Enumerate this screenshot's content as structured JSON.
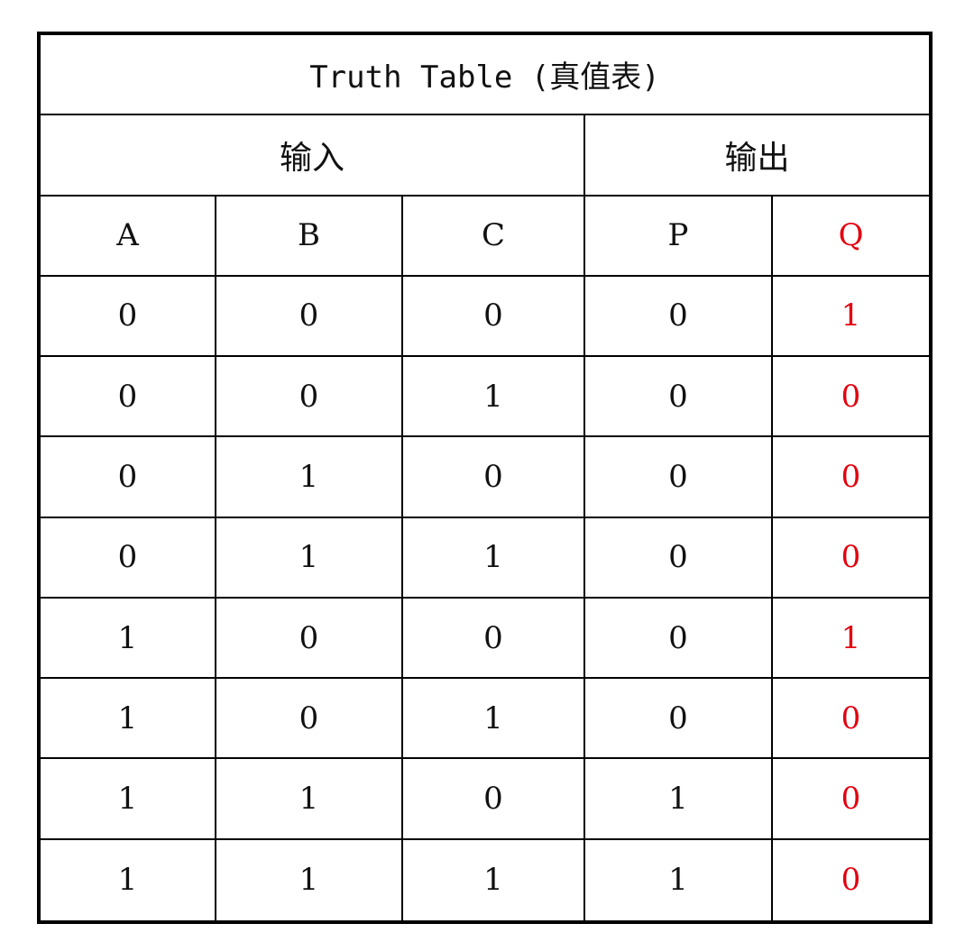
{
  "title": "Truth Table (真值表)",
  "groups": {
    "inputs": "输入",
    "outputs": "输出"
  },
  "columns": [
    "A",
    "B",
    "C",
    "P",
    "Q"
  ],
  "rows": [
    [
      "0",
      "0",
      "0",
      "0",
      "1"
    ],
    [
      "0",
      "0",
      "1",
      "0",
      "0"
    ],
    [
      "0",
      "1",
      "0",
      "0",
      "0"
    ],
    [
      "0",
      "1",
      "1",
      "0",
      "0"
    ],
    [
      "1",
      "0",
      "0",
      "0",
      "1"
    ],
    [
      "1",
      "0",
      "1",
      "0",
      "0"
    ],
    [
      "1",
      "1",
      "0",
      "1",
      "0"
    ],
    [
      "1",
      "1",
      "1",
      "1",
      "0"
    ]
  ],
  "colors": {
    "highlight_column": "#e3000f",
    "text": "#111111",
    "border": "#000000"
  },
  "highlight_column_index": 4
}
